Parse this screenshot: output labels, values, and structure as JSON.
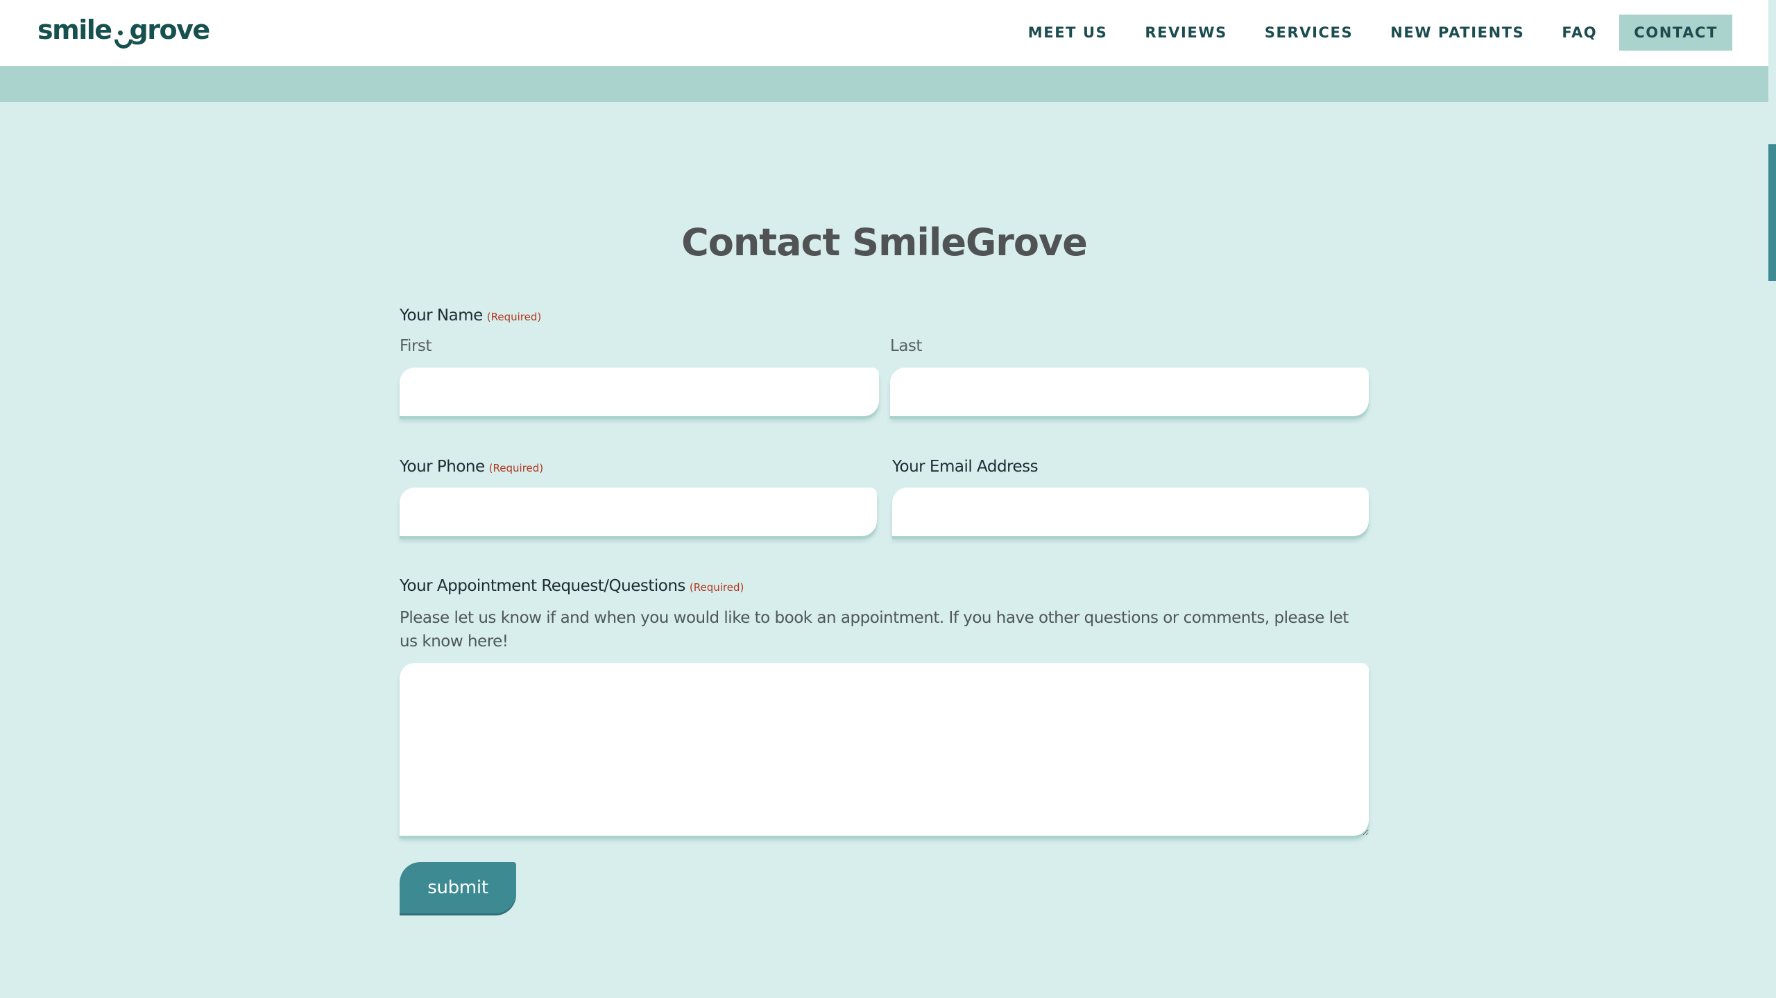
{
  "brand": {
    "logo_left": "smile",
    "logo_right": "grove",
    "colors": {
      "primary_dark": "#17514f",
      "accent": "#aad3ce",
      "background": "#d8eeec",
      "button": "#3d8a93",
      "required": "#b2361f"
    }
  },
  "nav": {
    "items": [
      {
        "label": "MEET US"
      },
      {
        "label": "REVIEWS"
      },
      {
        "label": "SERVICES"
      },
      {
        "label": "NEW PATIENTS"
      },
      {
        "label": "FAQ"
      },
      {
        "label": "CONTACT",
        "active": true
      }
    ]
  },
  "page": {
    "title": "Contact SmileGrove"
  },
  "form": {
    "name": {
      "label": "Your Name",
      "required_tag": "(Required)",
      "first_label": "First",
      "first_value": "",
      "last_label": "Last",
      "last_value": ""
    },
    "phone": {
      "label": "Your Phone",
      "required_tag": "(Required)",
      "value": ""
    },
    "email": {
      "label": "Your Email Address",
      "value": ""
    },
    "message": {
      "label": "Your Appointment Request/Questions",
      "required_tag": "(Required)",
      "description": "Please let us know if and when you would like to book an appointment. If you have other questions or comments, please let us know here!",
      "value": ""
    },
    "submit_label": "submit"
  }
}
